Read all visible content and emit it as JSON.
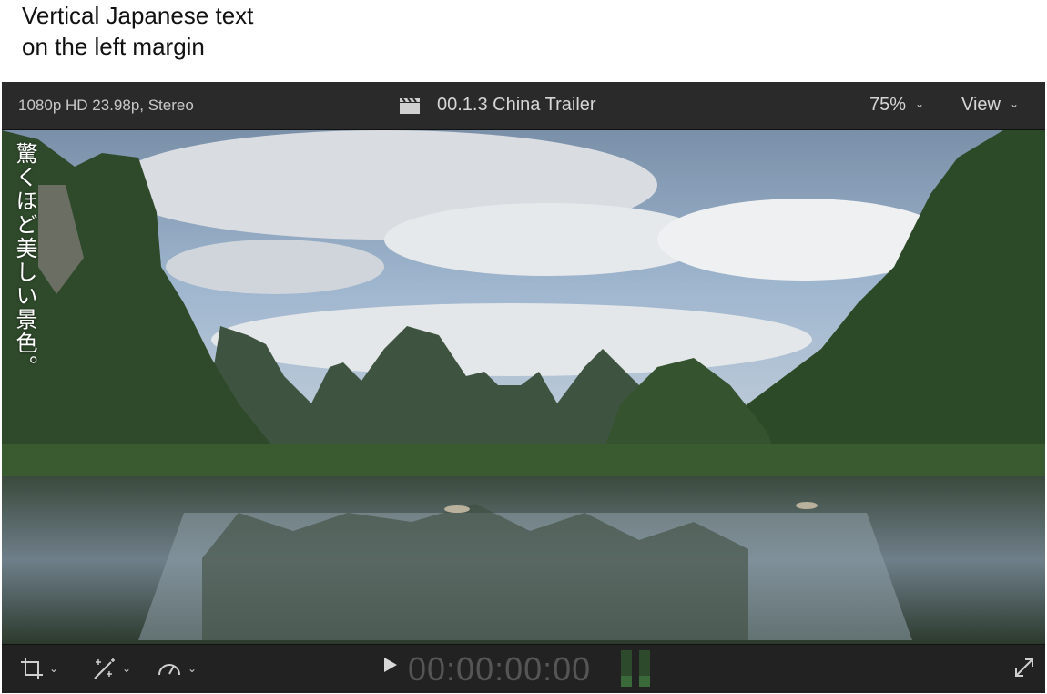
{
  "callout": {
    "line1": "Vertical Japanese text",
    "line2": "on the left margin"
  },
  "viewer": {
    "format": "1080p HD 23.98p, Stereo",
    "clip_title": "00.1.3 China Trailer",
    "zoom": "75%",
    "view_label": "View",
    "vertical_text": "驚くほど美しい景色。",
    "timecode": "00:00:00:00"
  },
  "icons": {
    "clapper": "clapperboard-icon",
    "crop": "crop-icon",
    "enhance": "magic-wand-icon",
    "speed": "speedometer-icon",
    "play": "play-icon",
    "fullscreen": "fullscreen-icon"
  }
}
